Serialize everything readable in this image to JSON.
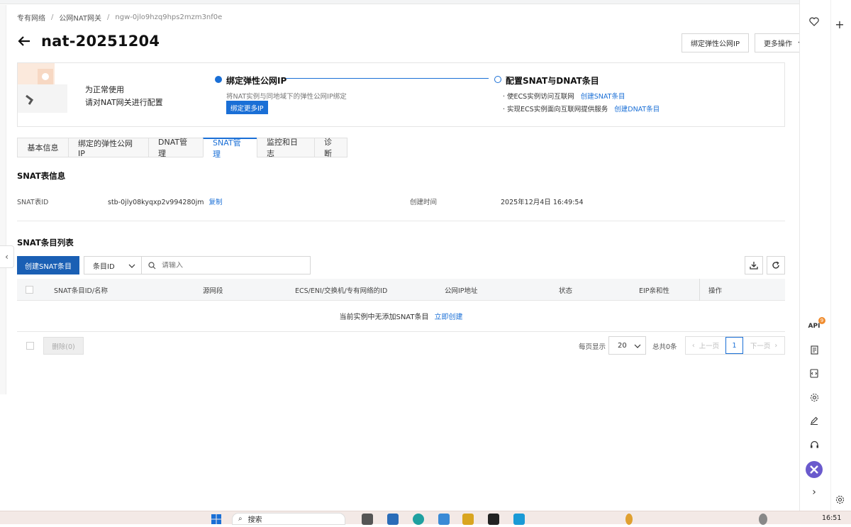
{
  "breadcrumb": [
    "专有网络",
    "公网NAT网关",
    "ngw-0jlo9hzq9hps2mzm3nf0e"
  ],
  "page_title": "nat-20251204",
  "header_actions": {
    "bind_eip": "绑定弹性公网IP",
    "more": "更多操作"
  },
  "guide": {
    "text_line1": "为正常使用",
    "text_line2": "请对NAT网关进行配置",
    "step1_title": "绑定弹性公网IP",
    "step1_desc": "将NAT实例与同地域下的弹性公网IP绑定",
    "step1_button": "绑定更多IP",
    "step2_title": "配置SNAT与DNAT条目",
    "step2_item1_text": "· 使ECS实例访问互联网",
    "step2_item1_link": "创建SNAT条目",
    "step2_item2_text": "· 实现ECS实例面向互联网提供服务",
    "step2_item2_link": "创建DNAT条目"
  },
  "tabs": [
    "基本信息",
    "绑定的弹性公网IP",
    "DNAT管理",
    "SNAT管理",
    "监控和日志",
    "诊断"
  ],
  "active_tab": "SNAT管理",
  "snat_info": {
    "section_title": "SNAT表信息",
    "id_label": "SNAT表ID",
    "id_value": "stb-0jly08kyqxp2v994280jm",
    "copy": "复制",
    "created_label": "创建时间",
    "created_value": "2025年12月4日 16:49:54"
  },
  "snat_list": {
    "section_title": "SNAT条目列表",
    "create_button": "创建SNAT条目",
    "filter_field": "条目ID",
    "search_placeholder": "请输入",
    "columns": [
      "SNAT条目ID/名称",
      "源网段",
      "ECS/ENI/交换机/专有网络的ID",
      "公网IP地址",
      "状态",
      "EIP亲和性",
      "操作"
    ],
    "empty_text": "当前实例中无添加SNAT条目",
    "empty_link": "立即创建",
    "delete_button": "删除(0)",
    "page_size_label": "每页显示",
    "page_size": "20",
    "total": "总共0条",
    "prev": "上一页",
    "current_page": "1",
    "next": "下一页"
  },
  "rightbar": {
    "api_label": "API",
    "api_badge": "9"
  },
  "taskbar": {
    "search": "搜索",
    "time": "16:51"
  },
  "colors": {
    "primary": "#1a6fd6",
    "button_dark": "#1a5fb4",
    "badge": "#f08c2e"
  }
}
